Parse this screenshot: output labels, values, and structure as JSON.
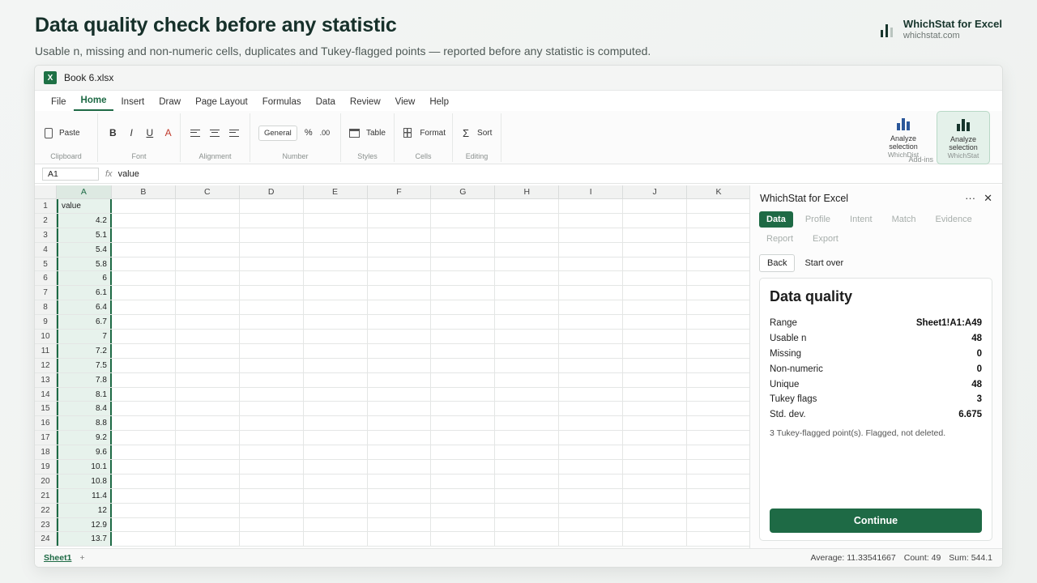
{
  "header": {
    "title": "Data quality check before any statistic",
    "subtitle": "Usable n, missing and non-numeric cells, duplicates and Tukey-flagged points — reported before any statistic is computed.",
    "brand_name": "WhichStat for Excel",
    "brand_url": "whichstat.com"
  },
  "window": {
    "filename": "Book 6.xlsx",
    "app_icon": "X"
  },
  "tabs": [
    "File",
    "Home",
    "Insert",
    "Draw",
    "Page Layout",
    "Formulas",
    "Data",
    "Review",
    "View",
    "Help"
  ],
  "ribbon": {
    "clipboard": {
      "paste": "Paste",
      "label": "Clipboard"
    },
    "font": {
      "bold": "B",
      "italic": "I",
      "underline": "U",
      "color": "A",
      "label": "Font"
    },
    "alignment": {
      "label": "Alignment"
    },
    "number": {
      "format": "General",
      "percent": "%",
      "decimals": ".00",
      "label": "Number"
    },
    "styles": {
      "table": "Table",
      "label": "Styles"
    },
    "cells": {
      "format": "Format",
      "label": "Cells"
    },
    "editing": {
      "sigma": "Σ",
      "sort": "Sort",
      "label": "Editing"
    },
    "addins": {
      "label": "Add-ins",
      "items": [
        {
          "line1": "Analyze",
          "line2": "selection",
          "sub": "WhichDist"
        },
        {
          "line1": "Analyze",
          "line2": "selection",
          "sub": "WhichStat"
        }
      ]
    }
  },
  "formula_bar": {
    "name_box": "A1",
    "fx": "fx",
    "value": "value"
  },
  "grid": {
    "columns": [
      "A",
      "B",
      "C",
      "D",
      "E",
      "F",
      "G",
      "H",
      "I",
      "J",
      "K"
    ],
    "header_cell": "value",
    "rows": [
      {
        "n": "1",
        "a": "value"
      },
      {
        "n": "2",
        "a": "4.2"
      },
      {
        "n": "3",
        "a": "5.1"
      },
      {
        "n": "4",
        "a": "5.4"
      },
      {
        "n": "5",
        "a": "5.8"
      },
      {
        "n": "6",
        "a": "6"
      },
      {
        "n": "7",
        "a": "6.1"
      },
      {
        "n": "8",
        "a": "6.4"
      },
      {
        "n": "9",
        "a": "6.7"
      },
      {
        "n": "10",
        "a": "7"
      },
      {
        "n": "11",
        "a": "7.2"
      },
      {
        "n": "12",
        "a": "7.5"
      },
      {
        "n": "13",
        "a": "7.8"
      },
      {
        "n": "14",
        "a": "8.1"
      },
      {
        "n": "15",
        "a": "8.4"
      },
      {
        "n": "16",
        "a": "8.8"
      },
      {
        "n": "17",
        "a": "9.2"
      },
      {
        "n": "18",
        "a": "9.6"
      },
      {
        "n": "19",
        "a": "10.1"
      },
      {
        "n": "20",
        "a": "10.8"
      },
      {
        "n": "21",
        "a": "11.4"
      },
      {
        "n": "22",
        "a": "12"
      },
      {
        "n": "23",
        "a": "12.9"
      },
      {
        "n": "24",
        "a": "13.7"
      }
    ]
  },
  "statusbar": {
    "sheet": "Sheet1",
    "add": "+",
    "average": "Average: 11.33541667",
    "count": "Count: 49",
    "sum": "Sum: 544.1"
  },
  "pane": {
    "title": "WhichStat for Excel",
    "more": "···",
    "close": "✕",
    "steps": [
      "Data",
      "Profile",
      "Intent",
      "Match",
      "Evidence",
      "Report",
      "Export"
    ],
    "back": "Back",
    "start_over": "Start over",
    "card": {
      "title": "Data quality",
      "rows": [
        {
          "k": "Range",
          "v": "Sheet1!A1:A49"
        },
        {
          "k": "Usable n",
          "v": "48"
        },
        {
          "k": "Missing",
          "v": "0"
        },
        {
          "k": "Non-numeric",
          "v": "0"
        },
        {
          "k": "Unique",
          "v": "48"
        },
        {
          "k": "Tukey flags",
          "v": "3"
        },
        {
          "k": "Std. dev.",
          "v": "6.675"
        }
      ],
      "note": "3 Tukey-flagged point(s). Flagged, not deleted.",
      "continue": "Continue"
    }
  },
  "colors": {
    "accent": "#1e6a45",
    "brand_dark": "#17352c",
    "selection_fill": "#e7f2ec"
  }
}
